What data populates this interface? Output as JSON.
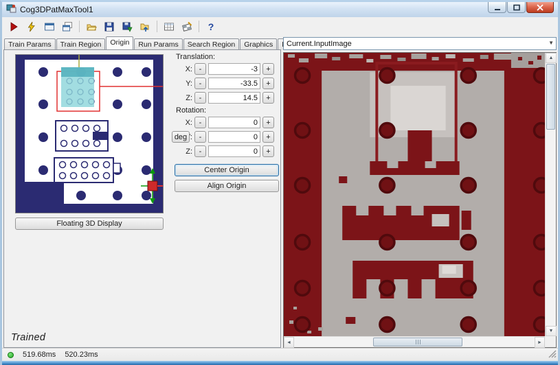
{
  "window": {
    "title": "Cog3DPatMaxTool1"
  },
  "toolbar": {
    "icons": [
      "run",
      "electric-run",
      "show-display",
      "float-display",
      "open-file",
      "save-file",
      "save-image",
      "load-image",
      "results-table",
      "calibration",
      "help"
    ],
    "help_glyph": "?"
  },
  "tabs": [
    "Train Params",
    "Train Region",
    "Origin",
    "Run Params",
    "Search Region",
    "Graphics",
    "Results"
  ],
  "active_tab": "Origin",
  "origin_tab": {
    "floating_display_button": "Floating 3D Display",
    "trained_status": "Trained",
    "translation": {
      "label": "Translation:",
      "x_label": "X:",
      "y_label": "Y:",
      "z_label": "Z:",
      "x": "-3",
      "y": "-33.5",
      "z": "14.5"
    },
    "rotation": {
      "label": "Rotation:",
      "x_label": "X:",
      "y_label": "Y:",
      "z_label": "Z:",
      "x": "0",
      "y": "0",
      "z": "0",
      "deg_button": "deg"
    },
    "minus_label": "-",
    "plus_label": "+",
    "center_origin_button": "Center Origin",
    "align_origin_button": "Align Origin"
  },
  "right_panel": {
    "image_selector_value": "Current.InputImage",
    "dropdown_glyph": "▼"
  },
  "status_bar": {
    "time1": "519.68ms",
    "time2": "520.23ms"
  },
  "scrollbar": {
    "up": "▲",
    "down": "▼",
    "left": "◄",
    "right": "►"
  },
  "colors": {
    "scene_navy": "#2b2b72",
    "scene_maroon": "#7c1418",
    "scene_gray": "#b2adaa",
    "highlight_cyan": "#8ed6da",
    "axis_red": "#d42a2a",
    "axis_green": "#0a9a0a",
    "status_ok_green": "#2db82d"
  }
}
